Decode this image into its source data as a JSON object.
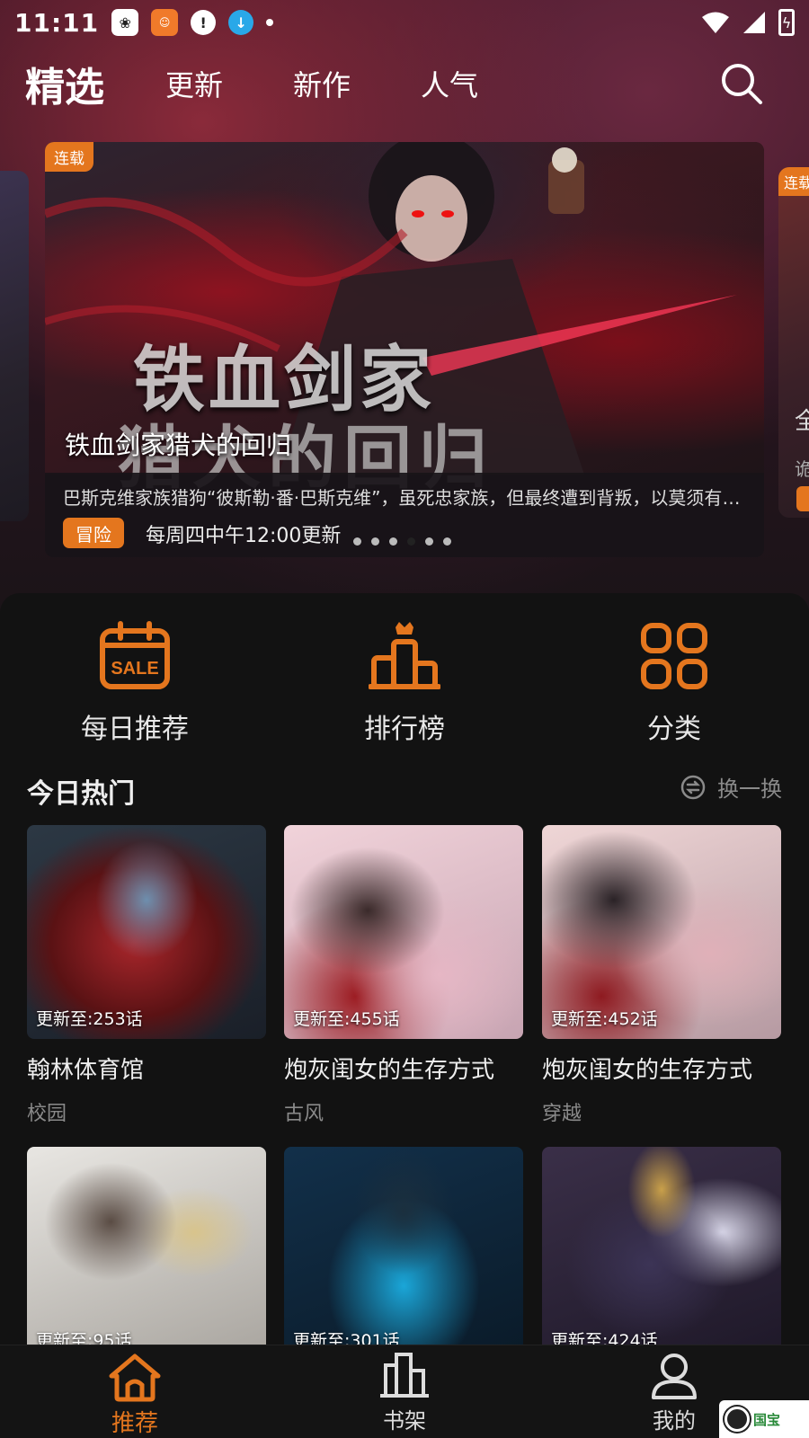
{
  "status_bar": {
    "time": "11:11",
    "icons_left": [
      "paw-app-icon",
      "manga-app-icon",
      "alert-icon",
      "download-icon",
      "notification-dot"
    ],
    "icons_right": [
      "wifi-icon",
      "signal-icon",
      "battery-charging-icon"
    ]
  },
  "top_nav": {
    "tabs": [
      {
        "label": "精选",
        "active": true
      },
      {
        "label": "更新",
        "active": false
      },
      {
        "label": "新作",
        "active": false
      },
      {
        "label": "人气",
        "active": false
      }
    ],
    "search_icon": "search-icon"
  },
  "banner": {
    "tag": "连载",
    "art_title_line1": "铁血剑家",
    "art_title_line2": "猎犬的回归",
    "title": "铁血剑家猎犬的回归",
    "description": "巴斯克维家族猎狗“彼斯勒·番·巴斯克维”，虽死忠家族，但最终遭到背叛，以莫须有的罪名被处死……",
    "genre": "冒险",
    "schedule": "每周四中午12:00更新",
    "dots_count": 6,
    "active_dot": 3,
    "side_right_tag": "连载",
    "side_right_glyph1": "全",
    "side_right_glyph2": "诡"
  },
  "quick_links": [
    {
      "label": "每日推荐",
      "icon": "calendar-sale-icon",
      "icon_text": "SALE"
    },
    {
      "label": "排行榜",
      "icon": "ranking-podium-icon"
    },
    {
      "label": "分类",
      "icon": "category-grid-icon"
    }
  ],
  "hot_section": {
    "title": "今日热门",
    "refresh_label": "换一换",
    "refresh_icon": "refresh-icon"
  },
  "comics": [
    {
      "update": "更新至:253话",
      "title": "翰林体育馆",
      "genre": "校园"
    },
    {
      "update": "更新至:455话",
      "title": "炮灰闺女的生存方式",
      "genre": "古风"
    },
    {
      "update": "更新至:452话",
      "title": "炮灰闺女的生存方式",
      "genre": "穿越"
    },
    {
      "update": "更新至:95话",
      "title": "",
      "genre": ""
    },
    {
      "update": "更新至:301话",
      "title": "",
      "genre": ""
    },
    {
      "update": "更新至:424话",
      "title": "",
      "genre": ""
    }
  ],
  "bottom_nav": [
    {
      "label": "推荐",
      "icon": "home-icon",
      "active": true
    },
    {
      "label": "书架",
      "icon": "bookshelf-icon",
      "active": false
    },
    {
      "label": "我的",
      "icon": "user-icon",
      "active": false
    }
  ],
  "colors": {
    "accent": "#e4761e",
    "background": "#121212"
  }
}
